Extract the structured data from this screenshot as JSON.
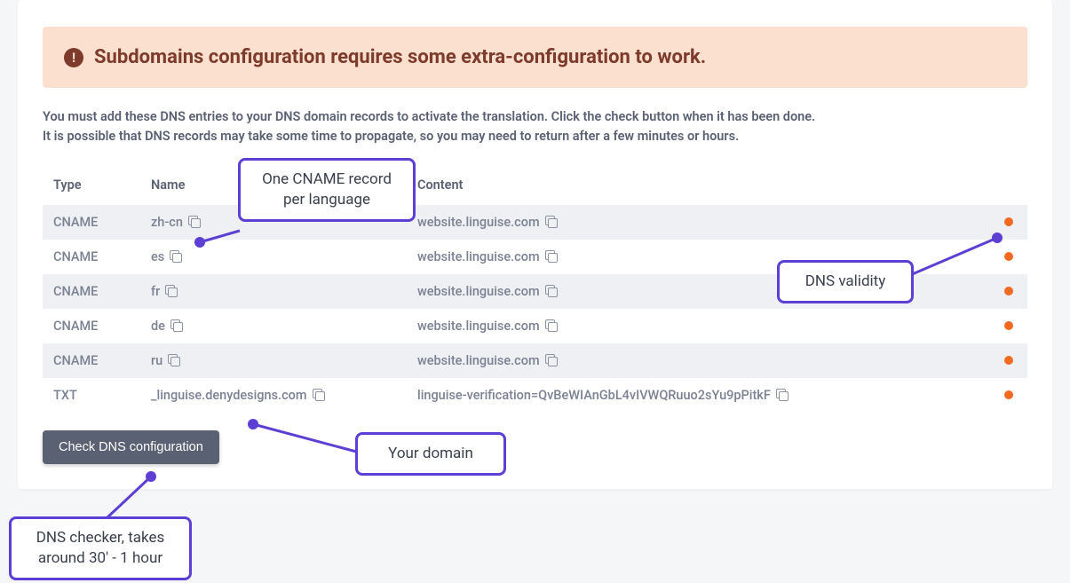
{
  "alert": {
    "icon_glyph": "!",
    "text": "Subdomains configuration requires some extra-configuration to work."
  },
  "instructions": {
    "line1": "You must add these DNS entries to your DNS domain records to activate the translation. Click the check button when it has been done.",
    "line2": "It is possible that DNS records may take some time to propagate, so you may need to return after a few minutes or hours."
  },
  "table": {
    "headers": {
      "type": "Type",
      "name": "Name",
      "content": "Content"
    },
    "rows": [
      {
        "type": "CNAME",
        "name": "zh-cn",
        "content": "website.linguise.com",
        "status": "pending"
      },
      {
        "type": "CNAME",
        "name": "es",
        "content": "website.linguise.com",
        "status": "pending"
      },
      {
        "type": "CNAME",
        "name": "fr",
        "content": "website.linguise.com",
        "status": "pending"
      },
      {
        "type": "CNAME",
        "name": "de",
        "content": "website.linguise.com",
        "status": "pending"
      },
      {
        "type": "CNAME",
        "name": "ru",
        "content": "website.linguise.com",
        "status": "pending"
      },
      {
        "type": "TXT",
        "name": "_linguise.denydesigns.com",
        "content": "linguise-verification=QvBeWIAnGbL4vIVWQRuuo2sYu9pPitkF",
        "status": "pending"
      }
    ]
  },
  "buttons": {
    "check_dns": "Check DNS configuration"
  },
  "callouts": {
    "cname_per_lang": "One CNAME record per language",
    "dns_validity": "DNS validity",
    "your_domain": "Your domain",
    "dns_checker": "DNS checker, takes around 30' - 1 hour"
  },
  "colors": {
    "status_pending": "#f26922",
    "accent": "#5d3fd3"
  }
}
